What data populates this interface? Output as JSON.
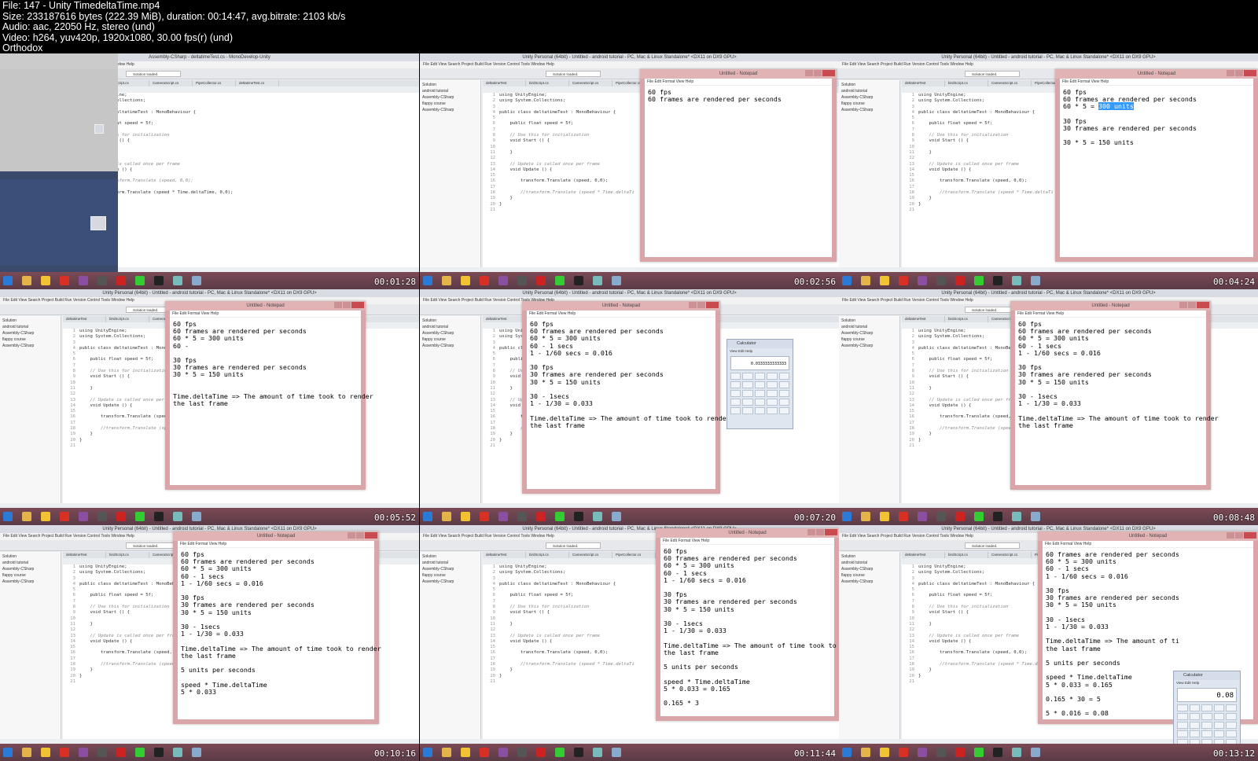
{
  "header": {
    "lines": [
      "File: 147 - Unity TimedeltaTime.mp4",
      "Size: 233187616 bytes (222.39 MiB), duration: 00:14:47, avg.bitrate: 2103 kb/s",
      "Audio: aac, 22050 Hz, stereo (und)",
      "Video: h264, yuv420p, 1920x1080, 30.00 fps(r) (und)",
      "Orthodox"
    ]
  },
  "common": {
    "unity_title": "Unity Personal (64bit) - Untitled - android tutorial - PC, Mac & Linux Standalone* <DX11 on DX9 GPU>",
    "mono_title": "Assembly-CSharp - deltatimeTest.cs - MonoDevelop-Unity",
    "mono_menu": "File  Edit  View  Search  Project  Build  Run  Version Control  Tools  Window  Help",
    "solution_status": "Solution loaded.",
    "notepad_title": "Untitled - Notepad",
    "notepad_menu": "File  Edit  Format  View  Help",
    "calc_title": "Calculator",
    "calc_menu": "View  Edit  Help",
    "solution_tree": [
      "Solution",
      "android tutorial",
      "Assembly-CSharp",
      "flappy course",
      "Assembly-CSharp"
    ],
    "tabs": [
      "deltatimeTest",
      "birdScript.cs",
      "CameraScript.cs",
      "PipeCollector.cs",
      "deltatimeTest.cs"
    ]
  },
  "frames": [
    {
      "time": "00:01:28",
      "code": [
        [
          "1",
          "using UnityEngine;"
        ],
        [
          "2",
          "using System.Collections;"
        ],
        [
          "3",
          ""
        ],
        [
          "4",
          "public class deltatimeTest : MonoBehaviour {"
        ],
        [
          "5",
          ""
        ],
        [
          "6",
          "    public float speed = 5f;"
        ],
        [
          "7",
          ""
        ],
        [
          "8",
          "    // Use this for initialization"
        ],
        [
          "9",
          "    void Start () {"
        ],
        [
          "10",
          ""
        ],
        [
          "11",
          "    }"
        ],
        [
          "12",
          ""
        ],
        [
          "13",
          "    // Update is called once per frame"
        ],
        [
          "14",
          "    void Update () {"
        ],
        [
          "15",
          ""
        ],
        [
          "16",
          "        //transform.Translate (speed, 0,0);"
        ],
        [
          "17",
          ""
        ],
        [
          "18",
          "        transform.Translate (speed * Time.deltaTime, 0,0);"
        ],
        [
          "19",
          "    }"
        ],
        [
          "20",
          "}"
        ],
        [
          "21",
          ""
        ]
      ]
    },
    {
      "time": "00:02:56",
      "notepad": [
        "60 fps",
        "60 frames are rendered per seconds"
      ],
      "code": [
        [
          "1",
          "using UnityEngine;"
        ],
        [
          "2",
          "using System.Collections;"
        ],
        [
          "3",
          ""
        ],
        [
          "4",
          "public class deltatimeTest : MonoBehaviour {"
        ],
        [
          "5",
          ""
        ],
        [
          "6",
          "    public float speed = 5f;"
        ],
        [
          "7",
          ""
        ],
        [
          "8",
          "    // Use this for initialization"
        ],
        [
          "9",
          "    void Start () {"
        ],
        [
          "10",
          ""
        ],
        [
          "11",
          "    }"
        ],
        [
          "12",
          ""
        ],
        [
          "13",
          "    // Update is called once per frame"
        ],
        [
          "14",
          "    void Update () {"
        ],
        [
          "15",
          ""
        ],
        [
          "16",
          "        transform.Translate (speed, 0,0);"
        ],
        [
          "17",
          ""
        ],
        [
          "18",
          "        //transform.Translate (speed * Time.deltaTi"
        ],
        [
          "19",
          "    }"
        ],
        [
          "20",
          "}"
        ],
        [
          "21",
          ""
        ]
      ]
    },
    {
      "time": "00:04:24",
      "notepad": [
        "60 fps",
        "60 frames are rendered per seconds",
        "60 * 5 = 300 units",
        "",
        "30 fps",
        "30 frames are rendered per seconds",
        "",
        "30 * 5 = 150 units"
      ],
      "selected": "300 units"
    },
    {
      "time": "00:05:52",
      "notepad": [
        "60 fps",
        "60 frames are rendered per seconds",
        "60 * 5 = 300 units",
        "60 -",
        "",
        "30 fps",
        "30 frames are rendered per seconds",
        "30 * 5 = 150 units",
        "",
        "",
        "Time.deltaTime => The amount of time took to render",
        "the last frame"
      ]
    },
    {
      "time": "00:07:20",
      "notepad": [
        "60 fps",
        "60 frames are rendered per seconds",
        "60 * 5 = 300 units",
        "60 - 1 secs",
        "1 - 1/60 secs = 0.016",
        "",
        "30 fps",
        "30 frames are rendered per seconds",
        "30 * 5 = 150 units",
        "",
        "30 - 1secs",
        "1 - 1/30 = 0.033",
        "",
        "Time.deltaTime => The amount of time took to render",
        "the last frame"
      ],
      "calc_display": "0.0333333333333"
    },
    {
      "time": "00:08:48",
      "notepad": [
        "60 fps",
        "60 frames are rendered per seconds",
        "60 * 5 = 300 units",
        "60 - 1 secs",
        "1 - 1/60 secs = 0.016",
        "",
        "30 fps",
        "30 frames are rendered per seconds",
        "30 * 5 = 150 units",
        "",
        "30 - 1secs",
        "1 - 1/30 = 0.033",
        "",
        "Time.deltaTime => The amount of time took to render",
        "the last frame"
      ]
    },
    {
      "time": "00:10:16",
      "notepad": [
        "60 fps",
        "60 frames are rendered per seconds",
        "60 * 5 = 300 units",
        "60 - 1 secs",
        "1 - 1/60 secs = 0.016",
        "",
        "30 fps",
        "30 frames are rendered per seconds",
        "30 * 5 = 150 units",
        "",
        "30 - 1secs",
        "1 - 1/30 = 0.033",
        "",
        "Time.deltaTime => The amount of time took to render",
        "the last frame",
        "",
        "5 units per seconds",
        "",
        "speed * Time.deltaTime",
        "5 * 0.033"
      ]
    },
    {
      "time": "00:11:44",
      "notepad": [
        "60 fps",
        "60 frames are rendered per seconds",
        "60 * 5 = 300 units",
        "60 - 1 secs",
        "1 - 1/60 secs = 0.016",
        "",
        "30 fps",
        "30 frames are rendered per seconds",
        "30 * 5 = 150 units",
        "",
        "30 - 1secs",
        "1 - 1/30 = 0.033",
        "",
        "Time.deltaTime => The amount of time took to rer",
        "the last frame",
        "",
        "5 units per seconds",
        "",
        "speed * Time.deltaTime",
        "5 * 0.033 = 0.165",
        "",
        "0.165 * 3"
      ]
    },
    {
      "time": "00:13:12",
      "notepad": [
        "60 frames are rendered per seconds",
        "60 * 5 = 300 units",
        "60 - 1 secs",
        "1 - 1/60 secs = 0.016",
        "",
        "30 fps",
        "30 frames are rendered per seconds",
        "30 * 5 = 150 units",
        "",
        "30 - 1secs",
        "1 - 1/30 = 0.033",
        "",
        "Time.deltaTime => The amount of ti",
        "the last frame",
        "",
        "5 units per seconds",
        "",
        "speed * Time.deltaTime",
        "5 * 0.033 = 0.165",
        "",
        "0.165 * 30 = 5",
        "",
        "5 * 0.016 = 0.08"
      ],
      "calc_display": "0.08"
    }
  ],
  "colors": {
    "notepad_border": "#d9a5a8",
    "taskbar": "#6b4250",
    "selection": "#3399ff"
  }
}
